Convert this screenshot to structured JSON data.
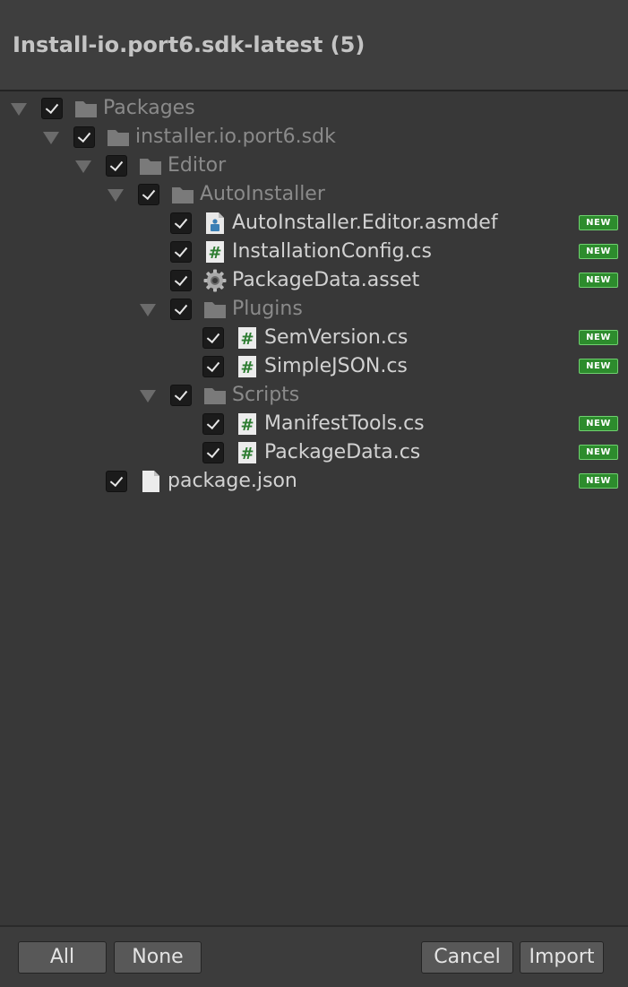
{
  "window": {
    "title": "Install-io.port6.sdk-latest (5)"
  },
  "tree": {
    "items": [
      {
        "label": "Packages",
        "type": "folder",
        "icon": "folder-icon",
        "checked": true,
        "expanded": true,
        "is_new": false
      },
      {
        "label": "installer.io.port6.sdk",
        "type": "folder",
        "icon": "folder-icon",
        "checked": true,
        "expanded": true,
        "is_new": false
      },
      {
        "label": "Editor",
        "type": "folder",
        "icon": "folder-icon",
        "checked": true,
        "expanded": true,
        "is_new": false
      },
      {
        "label": "AutoInstaller",
        "type": "folder",
        "icon": "folder-icon",
        "checked": true,
        "expanded": true,
        "is_new": false
      },
      {
        "label": "AutoInstaller.Editor.asmdef",
        "type": "file",
        "icon": "assembly-definition-icon",
        "checked": true,
        "is_new": true
      },
      {
        "label": "InstallationConfig.cs",
        "type": "file",
        "icon": "csharp-script-icon",
        "checked": true,
        "is_new": true
      },
      {
        "label": "PackageData.asset",
        "type": "file",
        "icon": "scriptable-object-gear-icon",
        "checked": true,
        "is_new": true
      },
      {
        "label": "Plugins",
        "type": "folder",
        "icon": "folder-icon",
        "checked": true,
        "expanded": true,
        "is_new": false
      },
      {
        "label": "SemVersion.cs",
        "type": "file",
        "icon": "csharp-script-icon",
        "checked": true,
        "is_new": true
      },
      {
        "label": "SimpleJSON.cs",
        "type": "file",
        "icon": "csharp-script-icon",
        "checked": true,
        "is_new": true
      },
      {
        "label": "Scripts",
        "type": "folder",
        "icon": "folder-icon",
        "checked": true,
        "expanded": true,
        "is_new": false
      },
      {
        "label": "ManifestTools.cs",
        "type": "file",
        "icon": "csharp-script-icon",
        "checked": true,
        "is_new": true
      },
      {
        "label": "PackageData.cs",
        "type": "file",
        "icon": "csharp-script-icon",
        "checked": true,
        "is_new": true
      },
      {
        "label": "package.json",
        "type": "file",
        "icon": "text-file-icon",
        "checked": true,
        "is_new": true
      }
    ],
    "new_badge_label": "NEW"
  },
  "footer": {
    "all_label": "All",
    "none_label": "None",
    "cancel_label": "Cancel",
    "import_label": "Import"
  },
  "colors": {
    "background": "#383838",
    "badge_green": "#2d8c2d",
    "script_hash_green": "#2e7d32",
    "asmdef_blue": "#3a7fb5"
  }
}
